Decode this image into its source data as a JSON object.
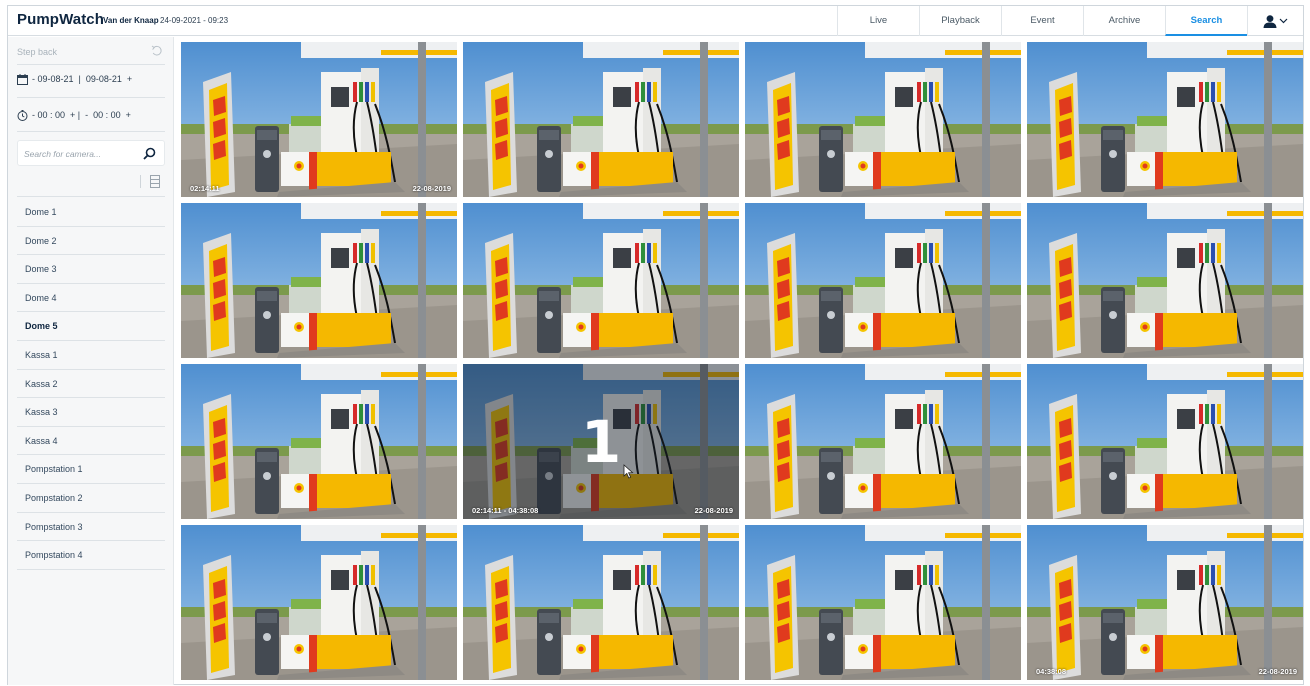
{
  "header": {
    "brand": "PumpWatch",
    "site": "Van der Knaap",
    "datetime": "24-09-2021 - 09:23",
    "nav": [
      "Live",
      "Playback",
      "Event",
      "Archive",
      "Search"
    ],
    "active_nav": "Search",
    "user_icon": "user-icon"
  },
  "sidebar": {
    "step_back": "Step back",
    "date_range": "- 09-08-21  |  09-08-21  +",
    "time_range": "- 00 : 00  + |  -  00 : 00  +",
    "search_placeholder": "Search for camera...",
    "cameras": [
      "Dome 1",
      "Dome 2",
      "Dome 3",
      "Dome 4",
      "Dome 5",
      "Kassa 1",
      "Kassa 2",
      "Kassa 3",
      "Kassa 4",
      "Pompstation 1",
      "Pompstation 2",
      "Pompstation 3",
      "Pompstation 4"
    ],
    "active_camera": "Dome 5"
  },
  "grid": {
    "tiles": [
      {
        "left": "02:14:11",
        "right": "22-08-2019"
      },
      {
        "left": "",
        "right": ""
      },
      {
        "left": "",
        "right": ""
      },
      {
        "left": "",
        "right": ""
      },
      {
        "left": "",
        "right": ""
      },
      {
        "left": "",
        "right": ""
      },
      {
        "left": "",
        "right": ""
      },
      {
        "left": "",
        "right": ""
      },
      {
        "left": "",
        "right": ""
      },
      {
        "left": "02:14:11 - 04:38:08",
        "right": "22-08-2019",
        "overlay": "1"
      },
      {
        "left": "",
        "right": ""
      },
      {
        "left": "",
        "right": ""
      },
      {
        "left": "",
        "right": ""
      },
      {
        "left": "",
        "right": ""
      },
      {
        "left": "",
        "right": ""
      },
      {
        "left": "04:38:08",
        "right": "22-08-2019"
      }
    ]
  },
  "colors": {
    "accent": "#1a8fe3",
    "brand": "#0f2640",
    "sky": "#6fa7dc",
    "shell_yellow": "#f5b800",
    "shell_red": "#e03a1e"
  }
}
